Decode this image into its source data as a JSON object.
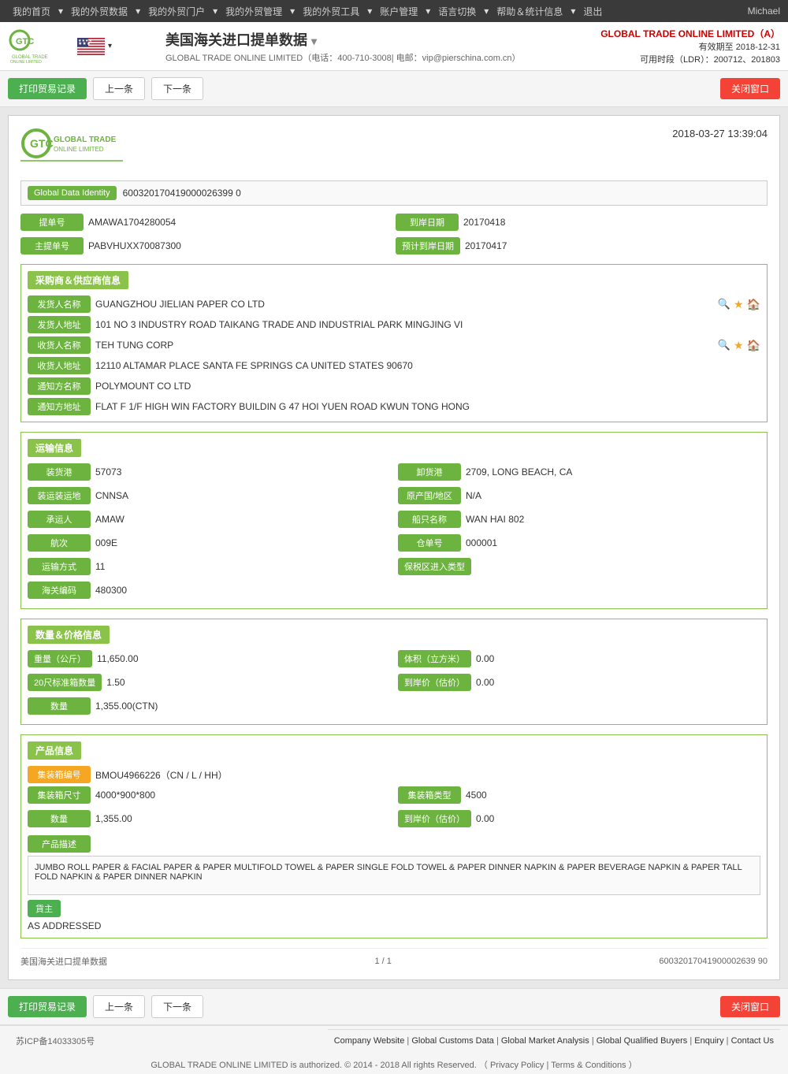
{
  "nav": {
    "items": [
      {
        "label": "我的首页",
        "id": "home"
      },
      {
        "label": "我的外贸数据",
        "id": "tradedata"
      },
      {
        "label": "我的外贸门户",
        "id": "portal"
      },
      {
        "label": "我的外贸管理",
        "id": "management"
      },
      {
        "label": "我的外贸工具",
        "id": "tools"
      },
      {
        "label": "账户管理",
        "id": "account"
      },
      {
        "label": "语言切换",
        "id": "language"
      },
      {
        "label": "帮助＆统计信息",
        "id": "help"
      },
      {
        "label": "退出",
        "id": "logout"
      }
    ],
    "user": "Michael"
  },
  "header": {
    "title": "美国海关进口提单数据",
    "contact_prefix": "GLOBAL TRADE ONLINE LIMITED（电话：",
    "phone": "400-710-3008",
    "email_label": "| 电邮：",
    "email": "vip@pierschina.com.cn",
    "contact_suffix": "）",
    "company": "GLOBAL TRADE ONLINE LIMITED（A）",
    "expire_label": "有效期至",
    "expire_date": "2018-12-31",
    "ldr_label": "可用时段（LDR）：",
    "ldr_value": "200712、201803"
  },
  "toolbar": {
    "print_label": "打印贸易记录",
    "prev_label": "上一条",
    "next_label": "下一条",
    "close_label": "关闭窗口"
  },
  "document": {
    "date": "2018-03-27  13:39:04",
    "global_data_identity_label": "Global Data Identity",
    "global_data_identity_value": "600320170419000026399 0",
    "bill_no_label": "提单号",
    "bill_no_value": "AMAWA1704280054",
    "arrival_date_label": "到岸日期",
    "arrival_date_value": "20170418",
    "master_bill_label": "主提单号",
    "master_bill_value": "PABVHUXX70087300",
    "estimated_arrival_label": "预计到岸日期",
    "estimated_arrival_value": "20170417"
  },
  "supplier_section": {
    "title": "采购商＆供应商信息",
    "shipper_name_label": "发货人名称",
    "shipper_name_value": "GUANGZHOU JIELIAN PAPER CO LTD",
    "shipper_addr_label": "发货人地址",
    "shipper_addr_value": "101 NO 3 INDUSTRY ROAD TAIKANG TRADE AND INDUSTRIAL PARK MINGJING VI",
    "consignee_name_label": "收货人名称",
    "consignee_name_value": "TEH TUNG CORP",
    "consignee_addr_label": "收货人地址",
    "consignee_addr_value": "12110 ALTAMAR PLACE SANTA FE SPRINGS CA UNITED STATES 90670",
    "notify_name_label": "通知方名称",
    "notify_name_value": "POLYMOUNT CO LTD",
    "notify_addr_label": "通知方地址",
    "notify_addr_value": "FLAT F 1/F HIGH WIN FACTORY BUILDIN G 47 HOI YUEN ROAD KWUN TONG HONG"
  },
  "transport_section": {
    "title": "运输信息",
    "loading_port_label": "装货港",
    "loading_port_value": "57073",
    "unloading_port_label": "卸货港",
    "unloading_port_value": "2709, LONG BEACH, CA",
    "loading_country_label": "装运装运地",
    "loading_country_value": "CNNSA",
    "origin_country_label": "原产国/地区",
    "origin_country_value": "N/A",
    "carrier_label": "承运人",
    "carrier_value": "AMAW",
    "vessel_label": "船只名称",
    "vessel_value": "WAN HAI 802",
    "voyage_label": "航次",
    "voyage_value": "009E",
    "warehouse_no_label": "仓单号",
    "warehouse_no_value": "000001",
    "transport_mode_label": "运输方式",
    "transport_mode_value": "11",
    "bonded_area_label": "保税区进入类型",
    "bonded_area_value": "",
    "customs_code_label": "海关编码",
    "customs_code_value": "480300"
  },
  "quantity_section": {
    "title": "数量＆价格信息",
    "weight_label": "重量（公斤）",
    "weight_value": "11,650.00",
    "volume_label": "体积（立方米）",
    "volume_value": "0.00",
    "container20_label": "20尺标准箱数量",
    "container20_value": "1.50",
    "arrival_price_label": "到岸价（估价）",
    "arrival_price_value": "0.00",
    "qty_label": "数量",
    "qty_value": "1,355.00(CTN)"
  },
  "product_section": {
    "title": "产品信息",
    "container_no_label": "集装箱编号",
    "container_no_value": "BMOU4966226（CN / L / HH）",
    "container_size_label": "集装箱尺寸",
    "container_size_value": "4000*900*800",
    "container_type_label": "集装箱类型",
    "container_type_value": "4500",
    "qty_label": "数量",
    "qty_value": "1,355.00",
    "arrival_price_label": "到岸价（估价）",
    "arrival_price_value": "0.00",
    "desc_label": "产品描述",
    "desc_value": "JUMBO ROLL PAPER & FACIAL PAPER & PAPER MULTIFOLD TOWEL & PAPER SINGLE FOLD TOWEL & PAPER DINNER NAPKIN & PAPER BEVERAGE NAPKIN & PAPER TALL FOLD NAPKIN & PAPER DINNER NAPKIN",
    "shipper_label": "貨主",
    "shipper_value": "AS ADDRESSED"
  },
  "doc_footer": {
    "source": "美国海关进口提单数据",
    "page_info": "1 / 1",
    "id_value": "60032017041900002639 90"
  },
  "bottom_toolbar": {
    "print_label": "打印贸易记录",
    "prev_label": "上一条",
    "next_label": "下一条",
    "close_label": "关闭窗口"
  },
  "footer": {
    "icp": "苏ICP备14033305号",
    "links": [
      {
        "label": "Company Website",
        "id": "company-website"
      },
      {
        "label": "Global Customs Data",
        "id": "customs-data"
      },
      {
        "label": "Global Market Analysis",
        "id": "market-analysis"
      },
      {
        "label": "Global Qualified Buyers",
        "id": "qualified-buyers"
      },
      {
        "label": "Enquiry",
        "id": "enquiry"
      },
      {
        "label": "Contact Us",
        "id": "contact-us"
      }
    ],
    "copyright": "GLOBAL TRADE ONLINE LIMITED is authorized. © 2014 - 2018 All rights Reserved.  （",
    "privacy": "Privacy Policy",
    "separator": " | ",
    "terms": "Terms & Conditions",
    "copyright_end": "）"
  }
}
